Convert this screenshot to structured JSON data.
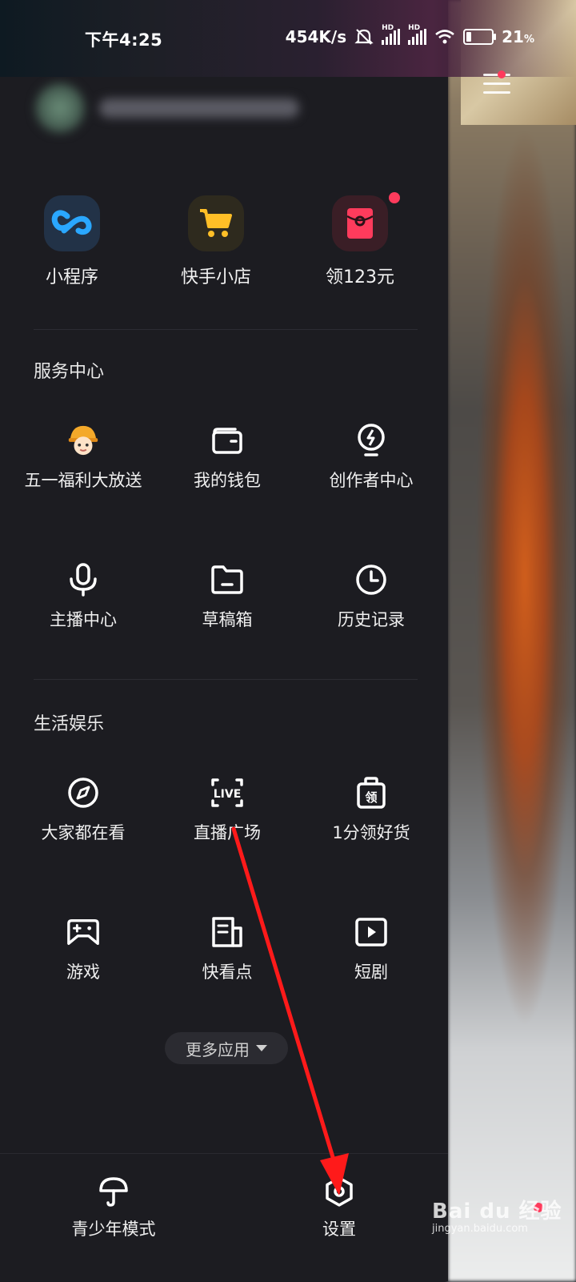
{
  "status_bar": {
    "time": "下午4:25",
    "network_speed": "454K/s",
    "battery": "21",
    "battery_unit": "%",
    "hd_label": "HD"
  },
  "quick_actions": [
    {
      "label": "小程序",
      "icon": "mini-program-icon",
      "color": "#2aa7ff",
      "badge": false
    },
    {
      "label": "快手小店",
      "icon": "shopping-cart-icon",
      "color": "#ffbf27",
      "badge": false
    },
    {
      "label": "领123元",
      "icon": "red-envelope-icon",
      "color": "#fe3b5c",
      "badge": true
    }
  ],
  "service_center": {
    "title": "服务中心",
    "items": [
      {
        "label": "五一福利大放送",
        "icon": "mascot-icon"
      },
      {
        "label": "我的钱包",
        "icon": "wallet-icon"
      },
      {
        "label": "创作者中心",
        "icon": "creator-bulb-icon"
      },
      {
        "label": "主播中心",
        "icon": "microphone-icon"
      },
      {
        "label": "草稿箱",
        "icon": "drafts-folder-icon"
      },
      {
        "label": "历史记录",
        "icon": "clock-icon"
      }
    ]
  },
  "life_entertainment": {
    "title": "生活娱乐",
    "items": [
      {
        "label": "大家都在看",
        "icon": "compass-icon"
      },
      {
        "label": "直播广场",
        "icon": "live-icon",
        "icon_text": "LIVE"
      },
      {
        "label": "1分领好货",
        "icon": "coupon-bag-icon",
        "icon_text": "领"
      },
      {
        "label": "游戏",
        "icon": "gamepad-icon"
      },
      {
        "label": "快看点",
        "icon": "news-icon"
      },
      {
        "label": "短剧",
        "icon": "play-icon"
      }
    ]
  },
  "more_apps": "更多应用",
  "bottom": {
    "teen_mode": "青少年模式",
    "settings": "设置"
  },
  "watermark": {
    "logo": "Bai du 经验",
    "url": "jingyan.baidu.com"
  },
  "colors": {
    "drawer_bg": "#1c1c21",
    "accent_red": "#fe3b5c",
    "annotation_arrow": "#ff1a1a"
  }
}
